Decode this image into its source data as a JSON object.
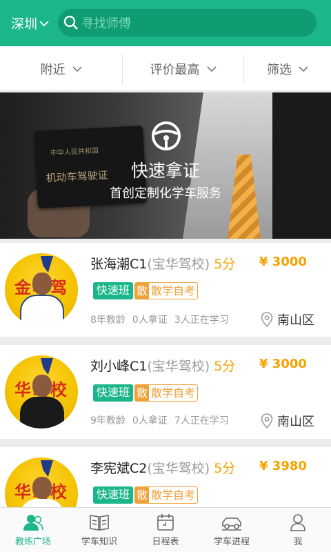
{
  "header": {
    "city": "深圳",
    "search_placeholder": "寻找师傅"
  },
  "filters": [
    "附近",
    "评价最高",
    "筛选"
  ],
  "banner": {
    "title": "快速拿证",
    "subtitle": "首创定制化学车服务",
    "card_line1": "中华人民共和国",
    "card_line2": "机动车驾驶证"
  },
  "coaches": [
    {
      "name": "张海潮C1",
      "school": "(宝华驾校)",
      "score": "5分",
      "price": "¥ 3000",
      "tag1": "快速班",
      "tag2_icon": "散",
      "tag2": "散学自考",
      "years": "8年教龄",
      "licensed": "0人拿证",
      "learning": "3人正在学习",
      "district": "南山区",
      "avatar_wall": "金华驾"
    },
    {
      "name": "刘小峰C1",
      "school": "(宝华驾校)",
      "score": "5分",
      "price": "¥ 3000",
      "tag1": "快速班",
      "tag2_icon": "散",
      "tag2": "散学自考",
      "years": "9年教龄",
      "licensed": "0人拿证",
      "learning": "7人正在学习",
      "district": "南山区",
      "avatar_wall": "华驾校"
    },
    {
      "name": "李宪斌C2",
      "school": "(宝华驾校)",
      "score": "5分",
      "price": "¥ 3980",
      "tag1": "快速班",
      "tag2_icon": "散",
      "tag2": "散学自考",
      "avatar_wall": "华驾校"
    }
  ],
  "tabs": [
    "教练广场",
    "学车知识",
    "日程表",
    "学车进程",
    "我"
  ],
  "colors": {
    "brand": "#1bb68a",
    "accent": "#f4a300",
    "tag_orange": "#f0a23a"
  }
}
